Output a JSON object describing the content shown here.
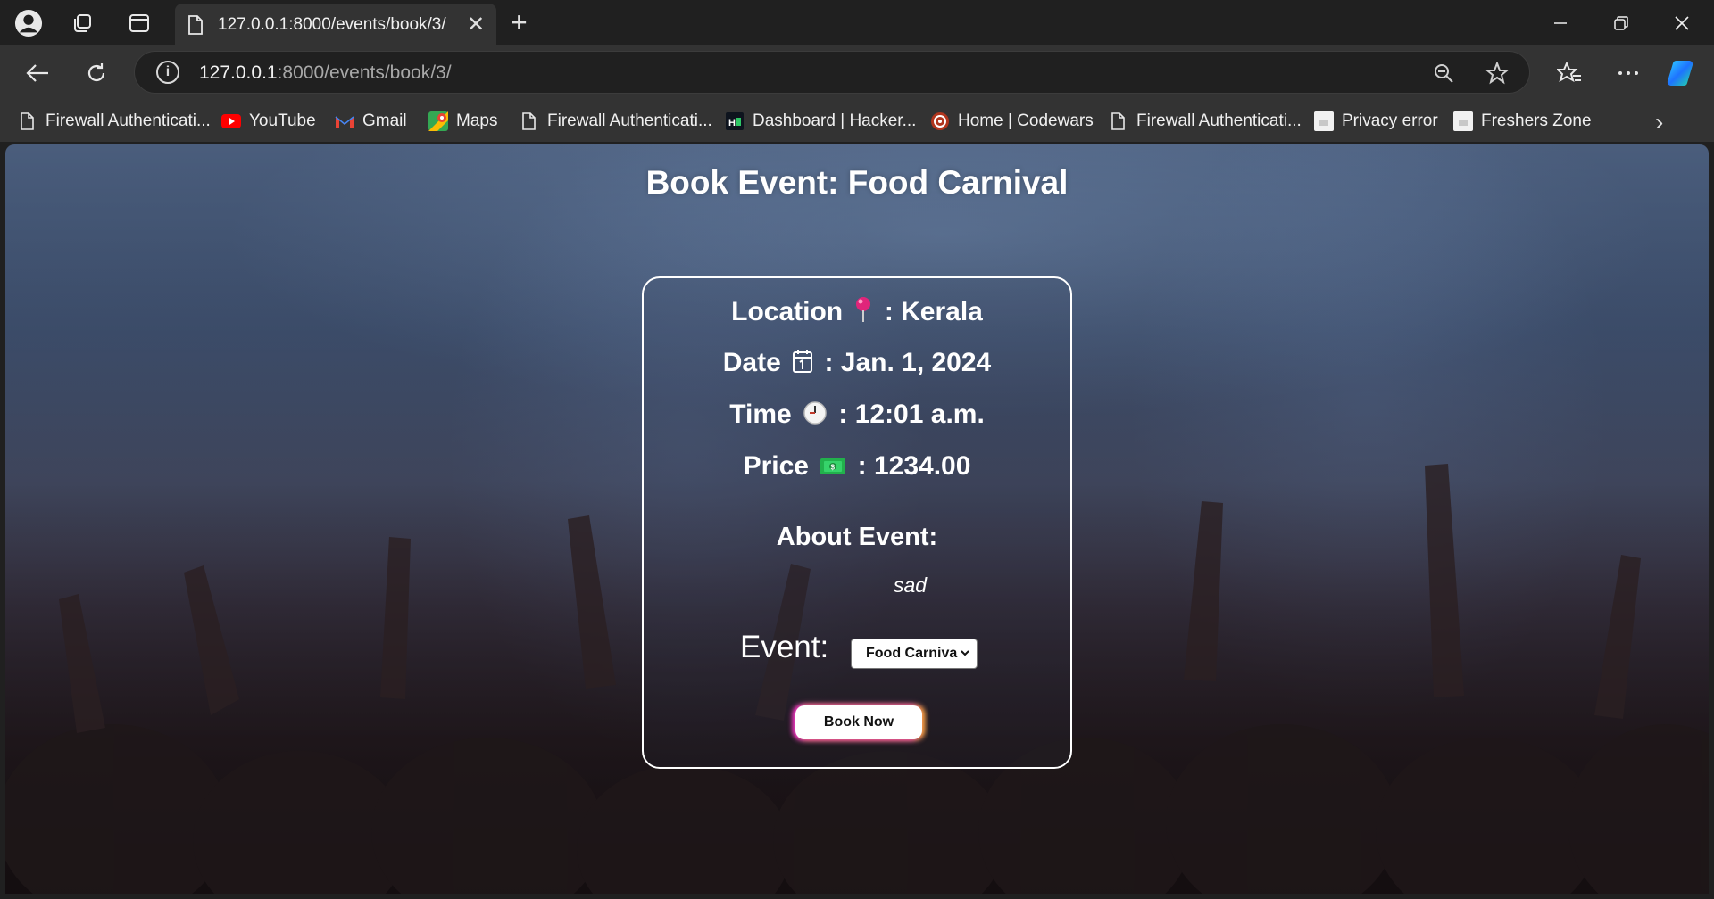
{
  "browser": {
    "tab": {
      "title": "127.0.0.1:8000/events/book/3/",
      "close": "✕"
    },
    "new_tab": "+",
    "window_controls": {
      "minimize": "—",
      "restore": "❐",
      "close": "✕"
    },
    "address": {
      "host": "127.0.0.1",
      "path": ":8000/events/book/3/"
    },
    "bookmarks": [
      {
        "label": "Firewall Authenticati...",
        "icon": "page-icon"
      },
      {
        "label": "YouTube",
        "icon": "youtube-icon"
      },
      {
        "label": "Gmail",
        "icon": "gmail-icon"
      },
      {
        "label": "Maps",
        "icon": "maps-icon"
      },
      {
        "label": "Firewall Authenticati...",
        "icon": "page-icon"
      },
      {
        "label": "Dashboard | Hacker...",
        "icon": "hackerrank-icon"
      },
      {
        "label": "Home | Codewars",
        "icon": "codewars-icon"
      },
      {
        "label": "Firewall Authenticati...",
        "icon": "page-icon"
      },
      {
        "label": "Privacy error",
        "icon": "privacy-error-icon"
      },
      {
        "label": "Freshers Zone",
        "icon": "page-icon"
      }
    ],
    "bookmarks_more": "›"
  },
  "page": {
    "title": "Book Event: Food Carnival",
    "details": {
      "location_label": "Location",
      "location_value": ": Kerala",
      "date_label": "Date",
      "date_value": ": Jan. 1, 2024",
      "time_label": "Time",
      "time_value": ": 12:01 a.m.",
      "price_label": "Price",
      "price_value": ": 1234.00"
    },
    "about_title": "About Event:",
    "about_text": "sad",
    "event_label": "Event:",
    "event_select_value": "Food Carniva",
    "book_button": "Book Now"
  },
  "colors": {
    "browser_chrome": "#333333",
    "title_bar": "#202020",
    "card_border": "#ffffff",
    "button_glow_left": "#ff2bd0",
    "button_glow_right": "#ffb02b"
  }
}
